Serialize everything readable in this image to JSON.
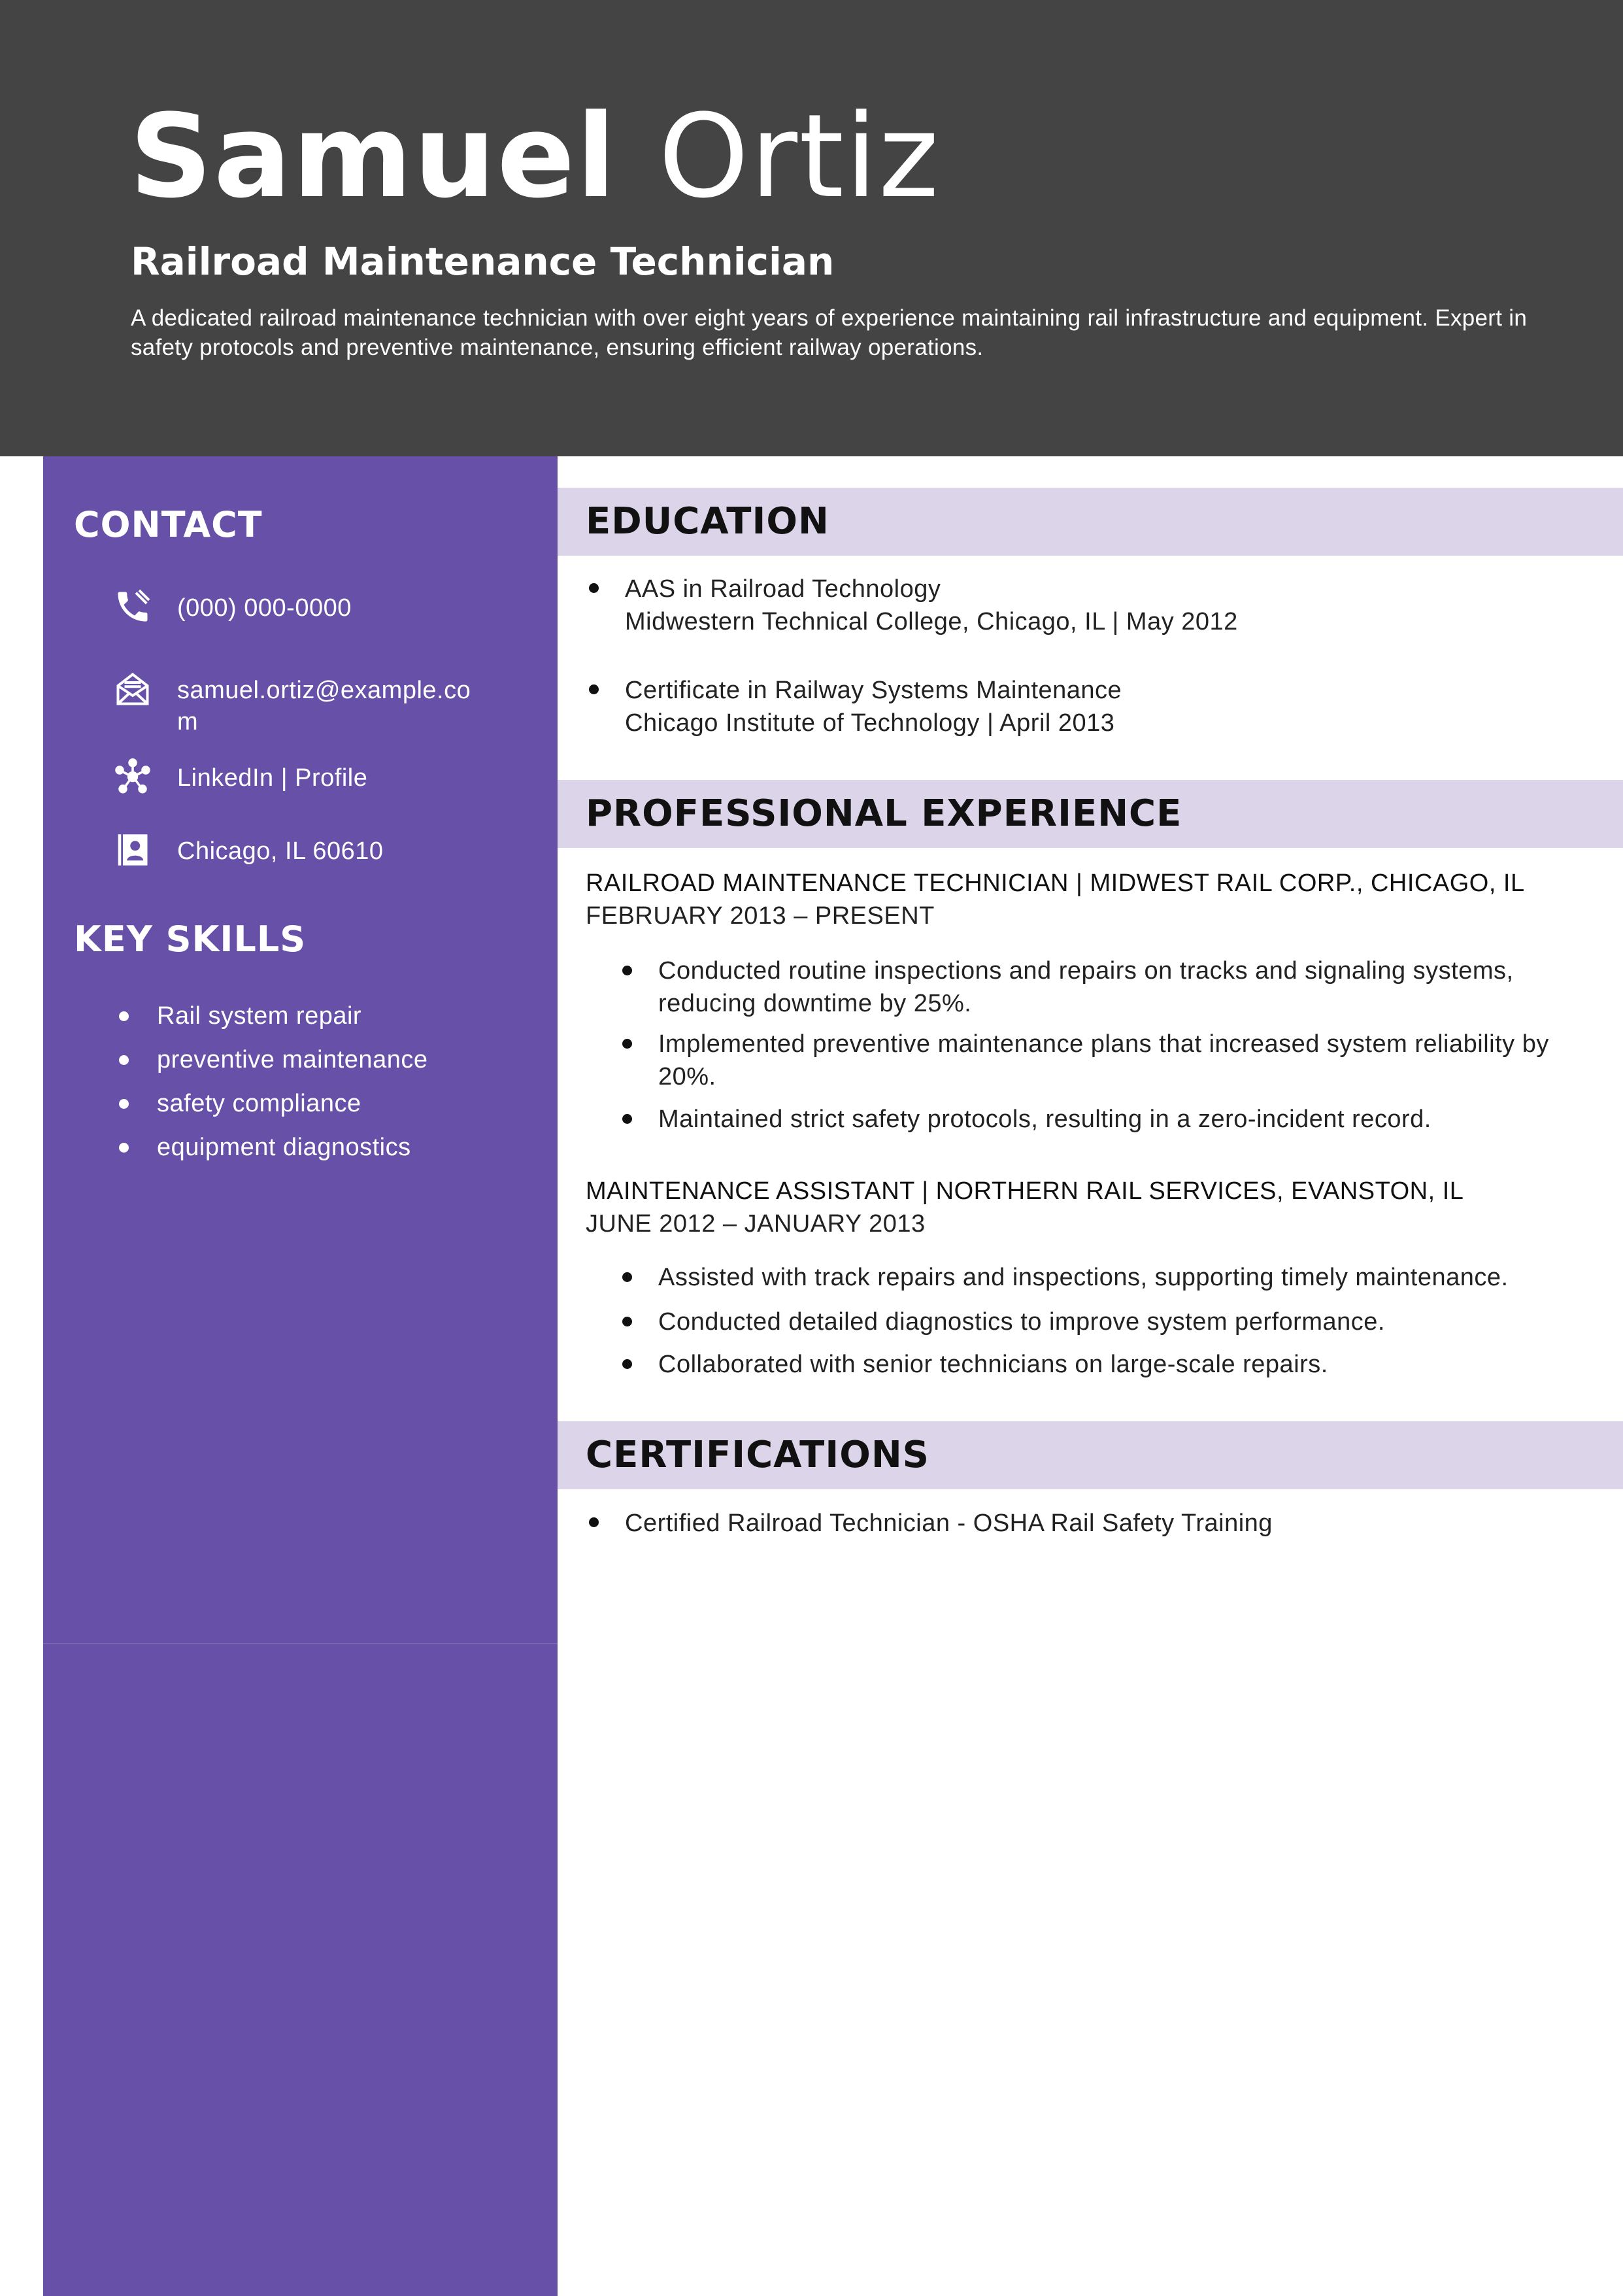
{
  "header": {
    "first_name": "Samuel",
    "last_name": "Ortiz",
    "job_title": "Railroad Maintenance Technician",
    "summary": "A dedicated railroad maintenance technician with over eight years of experience maintaining rail infrastructure and equipment. Expert in safety protocols and preventive maintenance, ensuring efficient railway operations."
  },
  "sidebar": {
    "contact_heading": "CONTACT",
    "contact": [
      {
        "icon": "phone-icon",
        "text": "(000) 000-0000"
      },
      {
        "icon": "email-icon",
        "text": "samuel.ortiz@example.com"
      },
      {
        "icon": "network-icon",
        "text": "LinkedIn | Profile"
      },
      {
        "icon": "address-card-icon",
        "text": "Chicago, IL 60610"
      }
    ],
    "skills_heading": "KEY SKILLS",
    "skills": [
      "Rail system repair",
      "preventive maintenance",
      "safety compliance",
      "equipment diagnostics"
    ]
  },
  "education": {
    "heading": "EDUCATION",
    "items": [
      {
        "degree": "AAS in Railroad Technology",
        "detail": "Midwestern Technical College, Chicago, IL | May 2012"
      },
      {
        "degree": "Certificate in Railway Systems Maintenance",
        "detail": "Chicago Institute of Technology | April 2013"
      }
    ]
  },
  "experience": {
    "heading": "PROFESSIONAL EXPERIENCE",
    "jobs": [
      {
        "title_line": "RAILROAD MAINTENANCE TECHNICIAN | MIDWEST RAIL CORP., CHICAGO, IL",
        "dates": "FEBRUARY 2013 – PRESENT",
        "bullets": [
          "Conducted routine inspections and repairs on tracks and signaling systems, reducing downtime by 25%.",
          "Implemented preventive maintenance plans that increased system reliability by 20%.",
          "Maintained strict safety protocols, resulting in a zero-incident record."
        ]
      },
      {
        "title_line": "MAINTENANCE ASSISTANT | NORTHERN RAIL SERVICES, EVANSTON, IL",
        "dates": "JUNE 2012 – JANUARY 2013",
        "bullets": [
          "Assisted with track repairs and inspections, supporting timely maintenance.",
          "Conducted detailed diagnostics to improve system performance.",
          "Collaborated with senior technicians on large-scale repairs."
        ]
      }
    ]
  },
  "certifications": {
    "heading": "CERTIFICATIONS",
    "items": [
      "Certified Railroad Technician - OSHA Rail Safety Training"
    ]
  },
  "colors": {
    "header_bg": "#444444",
    "sidebar_bg": "#6750a8",
    "section_bar_bg": "#dcd5e9"
  }
}
